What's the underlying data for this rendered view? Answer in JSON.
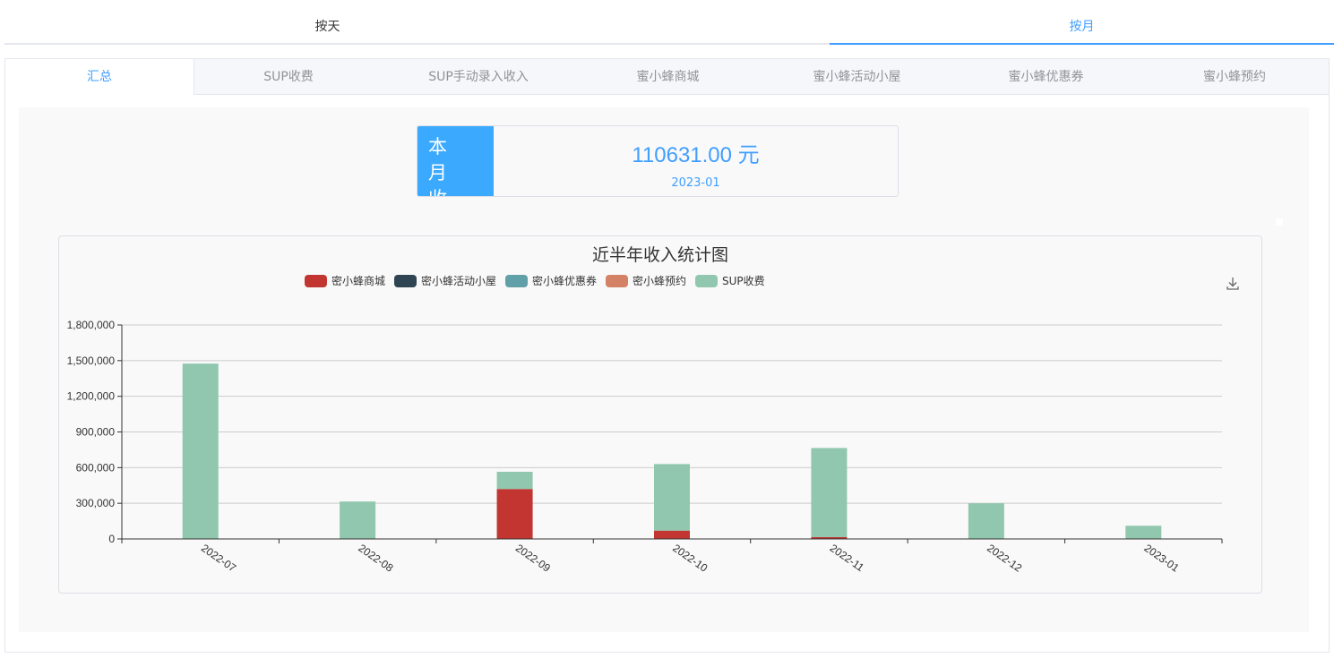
{
  "top_tabs": {
    "day": "按天",
    "month": "按月"
  },
  "sub_tabs": [
    "汇总",
    "SUP收费",
    "SUP手动录入收入",
    "蜜小蜂商城",
    "蜜小蜂活动小屋",
    "蜜小蜂优惠券",
    "蜜小蜂预约"
  ],
  "summary": {
    "label_line1": "本 月",
    "label_line2": "收 费",
    "amount": "110631.00 元",
    "month": "2023-01"
  },
  "colors": {
    "accent": "#409eff",
    "label_bg": "#3aa9fe",
    "series": [
      "#c23531",
      "#2f4554",
      "#61a0a8",
      "#d48265",
      "#91c7ae"
    ]
  },
  "icons": {
    "download": "download-icon"
  },
  "chart_data": {
    "type": "bar",
    "stacked": true,
    "title": "近半年收入统计图",
    "legend": [
      "密小蜂商城",
      "密小蜂活动小屋",
      "密小蜂优惠券",
      "密小蜂预约",
      "SUP收费"
    ],
    "legend_position": "top-center",
    "categories": [
      "2022-07",
      "2022-08",
      "2022-09",
      "2022-10",
      "2022-11",
      "2022-12",
      "2023-01"
    ],
    "series": [
      {
        "name": "密小蜂商城",
        "values": [
          0,
          0,
          420000,
          70000,
          15000,
          0,
          0
        ]
      },
      {
        "name": "密小蜂活动小屋",
        "values": [
          0,
          0,
          0,
          0,
          0,
          0,
          0
        ]
      },
      {
        "name": "密小蜂优惠券",
        "values": [
          0,
          0,
          0,
          0,
          0,
          0,
          0
        ]
      },
      {
        "name": "密小蜂预约",
        "values": [
          0,
          0,
          0,
          0,
          0,
          0,
          0
        ]
      },
      {
        "name": "SUP收费",
        "values": [
          1475000,
          315000,
          145000,
          560000,
          750000,
          300000,
          110631
        ]
      }
    ],
    "ylim": [
      0,
      1800000
    ],
    "yticks": [
      "0",
      "300,000",
      "600,000",
      "900,000",
      "1,200,000",
      "1,500,000",
      "1,800,000"
    ],
    "grid": true
  }
}
